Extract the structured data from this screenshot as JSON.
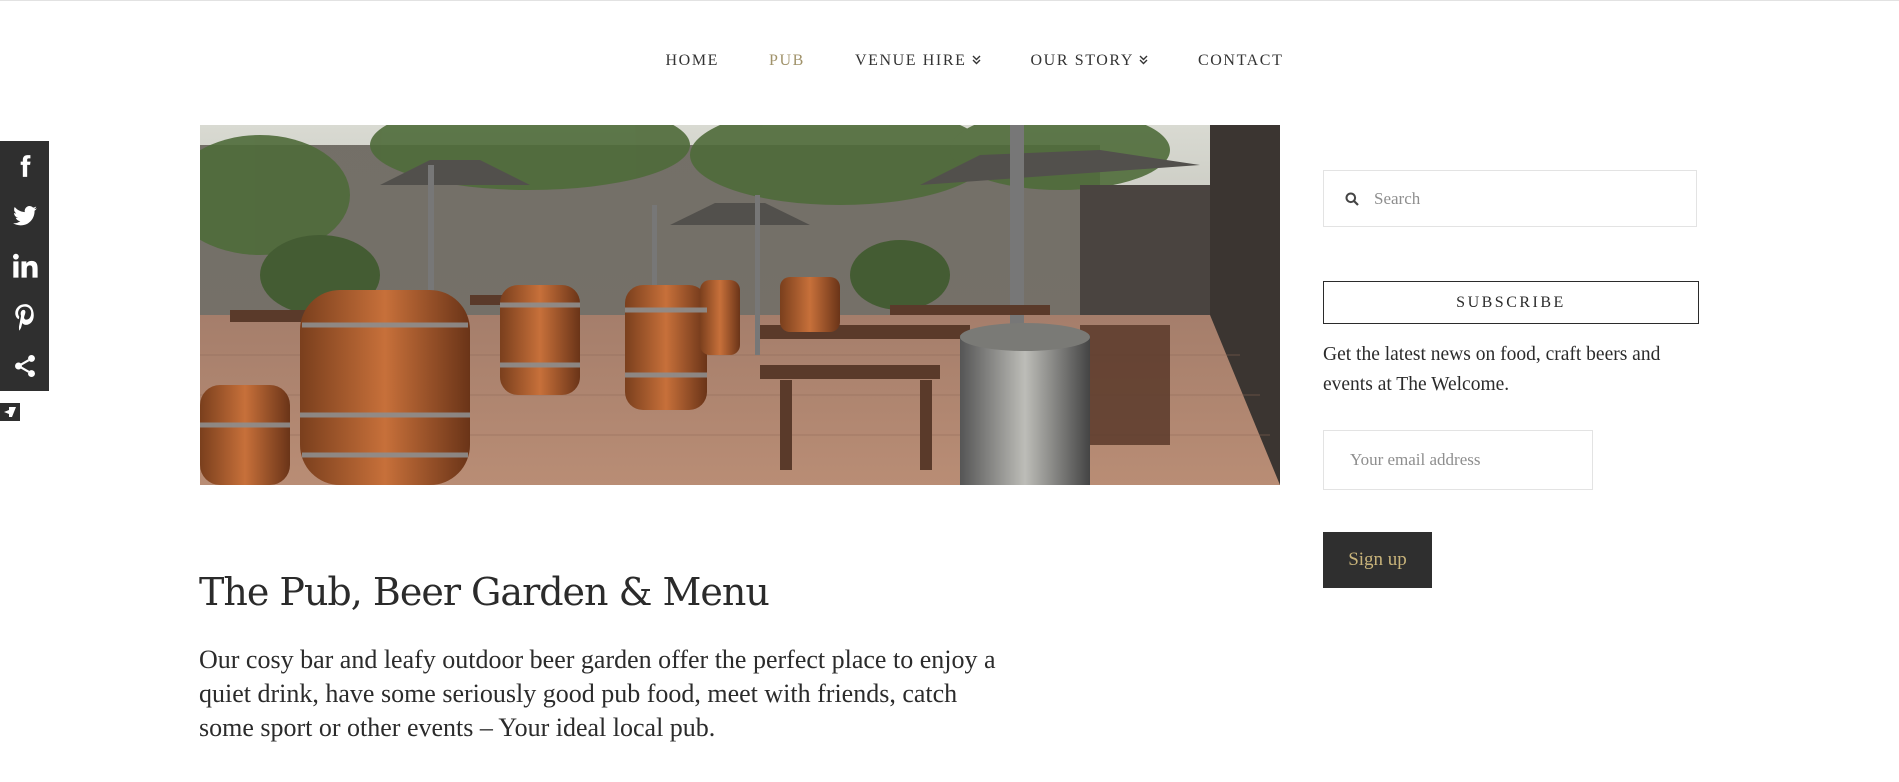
{
  "nav": {
    "items": [
      {
        "label": "HOME",
        "active": false,
        "dropdown": false
      },
      {
        "label": "PUB",
        "active": true,
        "dropdown": false
      },
      {
        "label": "VENUE HIRE",
        "active": false,
        "dropdown": true
      },
      {
        "label": "OUR STORY",
        "active": false,
        "dropdown": true
      },
      {
        "label": "CONTACT",
        "active": false,
        "dropdown": false
      }
    ],
    "caret": "»",
    "active_color": "#a0926a"
  },
  "social": {
    "icons": [
      "facebook-icon",
      "twitter-icon",
      "linkedin-icon",
      "pinterest-icon",
      "share-icon"
    ],
    "toggle_icon": "collapse-arrow-icon",
    "bar_color": "#2f2f2f"
  },
  "hero": {
    "image": "beer-garden-photo"
  },
  "main": {
    "title": "The Pub, Beer Garden & Menu",
    "intro": "Our cosy bar and leafy outdoor beer garden offer the perfect place to enjoy a quiet drink, have some seriously good pub food, meet with friends, catch some sport or other events – Your ideal local pub."
  },
  "sidebar": {
    "search": {
      "placeholder": "Search",
      "icon": "search-icon"
    },
    "subscribe": {
      "heading": "SUBSCRIBE",
      "text": "Get the latest news on food, craft beers and events at The Welcome.",
      "email_placeholder": "Your email address",
      "button_label": "Sign up",
      "button_color": "#2f2f2f",
      "button_text_color": "#c8b37a"
    }
  }
}
